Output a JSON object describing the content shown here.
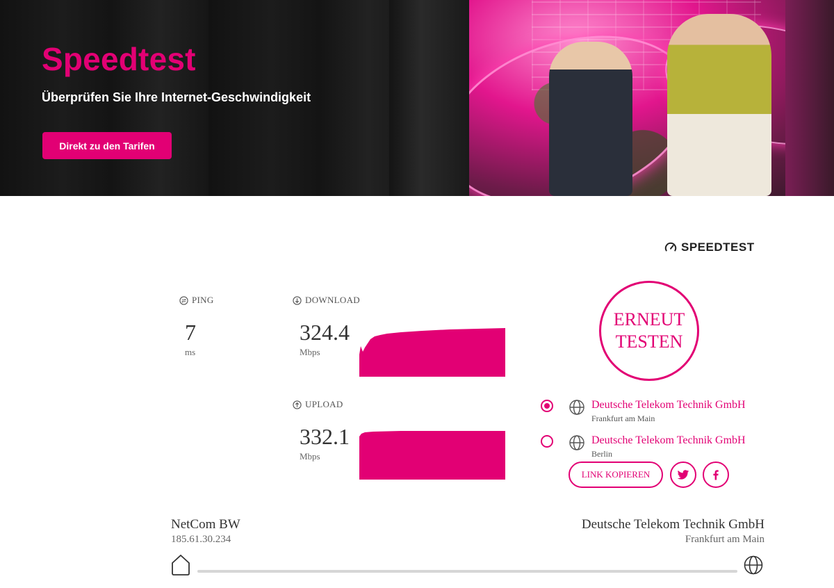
{
  "hero": {
    "title": "Speedtest",
    "subtitle": "Überprüfen Sie Ihre Internet-Geschwindigkeit",
    "cta_label": "Direkt zu den Tarifen"
  },
  "brand": {
    "logo_text": "SPEEDTEST",
    "accent_color": "#e20074"
  },
  "metrics": {
    "ping": {
      "label": "PING",
      "value": "7",
      "unit": "ms"
    },
    "download": {
      "label": "DOWNLOAD",
      "value": "324.4",
      "unit": "Mbps"
    },
    "upload": {
      "label": "UPLOAD",
      "value": "332.1",
      "unit": "Mbps"
    }
  },
  "retest": {
    "line1": "ERNEUT",
    "line2": "TESTEN"
  },
  "servers": [
    {
      "name": "Deutsche Telekom Technik GmbH",
      "city": "Frankfurt am Main",
      "selected": true
    },
    {
      "name": "Deutsche Telekom Technik GmbH",
      "city": "Berlin",
      "selected": false
    }
  ],
  "share": {
    "copy_link_label": "LINK KOPIEREN",
    "twitter_icon": "twitter-icon",
    "facebook_icon": "facebook-icon"
  },
  "connection": {
    "isp_name": "NetCom BW",
    "isp_ip": "185.61.30.234",
    "host_name": "Deutsche Telekom Technik GmbH",
    "host_city": "Frankfurt am Main"
  }
}
